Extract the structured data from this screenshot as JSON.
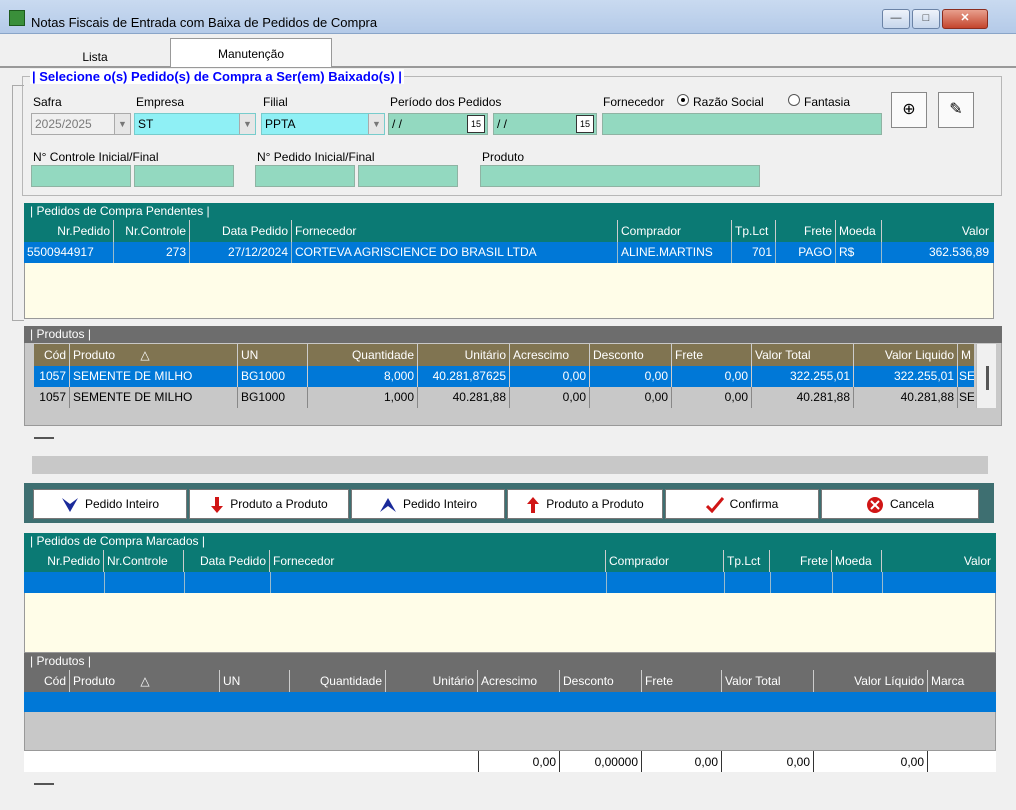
{
  "window": {
    "title": "Notas Fiscais de Entrada com Baixa de Pedidos de Compra",
    "minimize_label": "—",
    "maximize_label": "□",
    "close_label": "✕"
  },
  "tabs": [
    {
      "label": "Lista"
    },
    {
      "label": "Manutenção"
    }
  ],
  "filter": {
    "group_title": "| Selecione o(s) Pedido(s) de Compra a Ser(em) Baixado(s) |",
    "safra_label": "Safra",
    "safra_value": "2025/2025",
    "empresa_label": "Empresa",
    "empresa_value": "ST",
    "filial_label": "Filial",
    "filial_value": "PPTA",
    "periodo_label": "Período dos Pedidos",
    "periodo_inicio": " / /",
    "periodo_fim": " / /",
    "fornecedor_label": "Fornecedor",
    "radio_razao": "Razão Social",
    "radio_fantasia": "Fantasia",
    "controle_label": "N° Controle Inicial/Final",
    "pedido_label": "N° Pedido Inicial/Final",
    "produto_label": "Produto",
    "calendar_glyph": "15"
  },
  "pendentes": {
    "title": "| Pedidos de Compra Pendentes |",
    "headers": [
      "Nr.Pedido",
      "Nr.Controle",
      "Data Pedido",
      "Fornecedor",
      "Comprador",
      "Tp.Lct",
      "Frete",
      "Moeda",
      "Valor"
    ],
    "rows": [
      [
        "5500944917",
        "273",
        "27/12/2024",
        "CORTEVA AGRISCIENCE DO BRASIL LTDA",
        "ALINE.MARTINS",
        "701",
        "PAGO",
        "R$",
        "362.536,89"
      ]
    ]
  },
  "produtos1": {
    "title": "| Produtos |",
    "headers": [
      "Cód",
      "Produto",
      "UN",
      "Quantidade",
      "Unitário",
      "Acrescimo",
      "Desconto",
      "Frete",
      "Valor Total",
      "Valor Liquido",
      "M"
    ],
    "rows": [
      [
        "1057",
        "SEMENTE DE MILHO",
        "BG1000",
        "8,000",
        "40.281,87625",
        "0,00",
        "0,00",
        "0,00",
        "322.255,01",
        "322.255,01",
        "SE"
      ],
      [
        "1057",
        "SEMENTE DE MILHO",
        "BG1000",
        "1,000",
        "40.281,88",
        "0,00",
        "0,00",
        "0,00",
        "40.281,88",
        "40.281,88",
        "SE"
      ]
    ]
  },
  "actions": {
    "pedido_inteiro_1": "Pedido Inteiro",
    "produto_a_produto_1": "Produto a Produto",
    "pedido_inteiro_2": "Pedido Inteiro",
    "produto_a_produto_2": "Produto a Produto",
    "confirma": "Confirma",
    "cancela": "Cancela"
  },
  "marcados": {
    "title": "| Pedidos de Compra Marcados |",
    "headers": [
      "Nr.Pedido",
      "Nr.Controle",
      "Data Pedido",
      "Fornecedor",
      "Comprador",
      "Tp.Lct",
      "Frete",
      "Moeda",
      "Valor"
    ]
  },
  "produtos2": {
    "title": "| Produtos |",
    "headers": [
      "Cód",
      "Produto",
      "UN",
      "Quantidade",
      "Unitário",
      "Acrescimo",
      "Desconto",
      "Frete",
      "Valor Total",
      "Valor Líquido",
      "Marca"
    ],
    "totals": [
      "0,00",
      "0,00000",
      "0,00",
      "0,00",
      "0,00"
    ]
  },
  "sort_glyph": "△",
  "colors": {
    "teal": "#0b7a74",
    "selection": "#0078d7",
    "field_green": "#93d9c0",
    "field_cyan": "#8ff0f5"
  }
}
